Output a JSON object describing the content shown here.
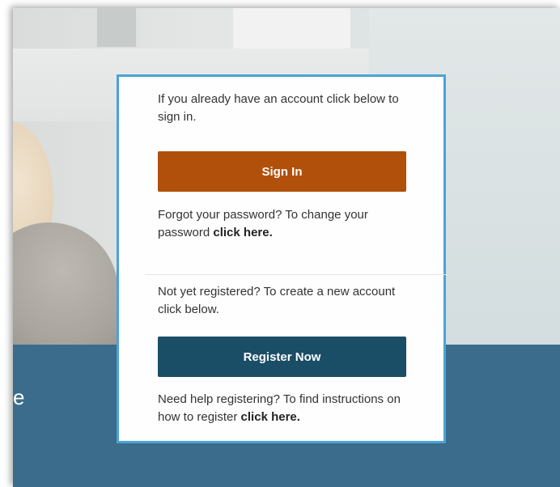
{
  "background": {
    "band_text": "e",
    "band_color": "#3b6c8b"
  },
  "card": {
    "border_color": "#4aa3d6",
    "signin_intro": "If you already have an account click below to sign in.",
    "signin_button": "Sign In",
    "forgot_prefix": "Forgot your password? To change your password ",
    "forgot_link": "click here.",
    "register_intro": "Not yet registered? To create a new account click below.",
    "register_button": "Register Now",
    "help_prefix": "Need help registering? To find instructions on how to register ",
    "help_link": "click here."
  },
  "colors": {
    "signin_button_bg": "#b0500b",
    "register_button_bg": "#1a4d66"
  }
}
